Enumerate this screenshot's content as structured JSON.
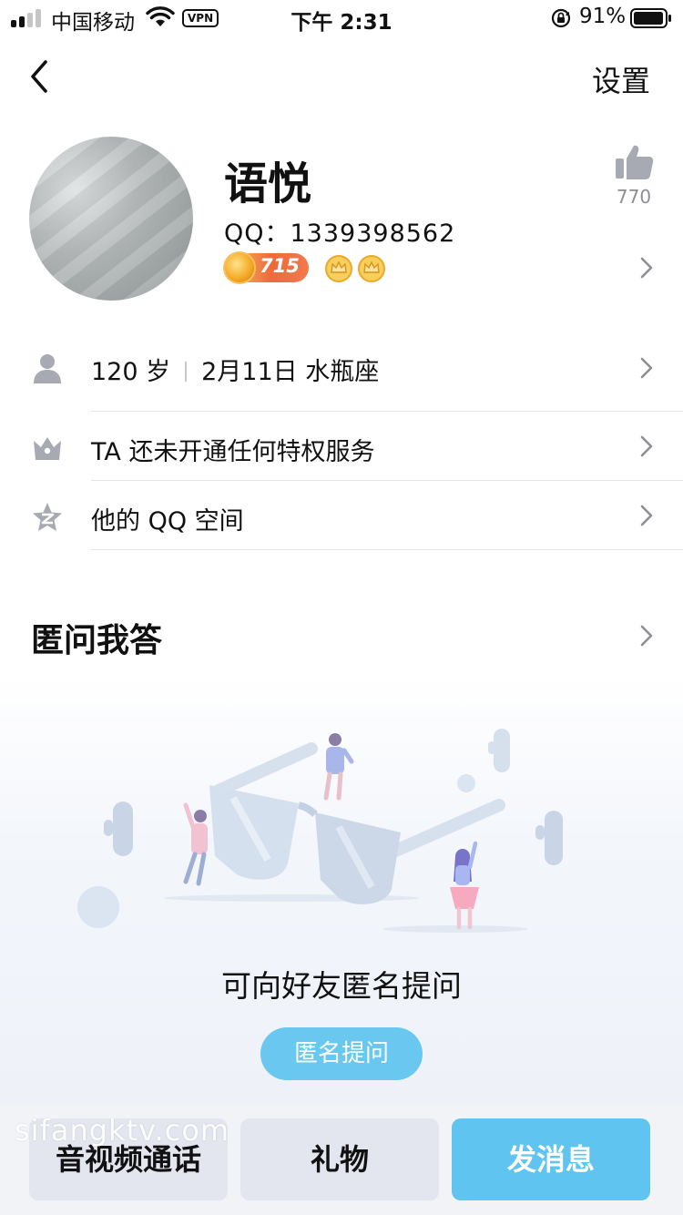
{
  "status_bar": {
    "carrier": "中国移动",
    "vpn": "VPN",
    "time": "下午 2:31",
    "battery_percent": "91%"
  },
  "nav": {
    "back_icon": "chevron-left-icon",
    "settings_label": "设置"
  },
  "profile": {
    "nickname": "语悦",
    "qq_number": "QQ：1339398562",
    "level": "715",
    "crown_count": 2,
    "likes": "770"
  },
  "info_rows": [
    {
      "icon": "person-icon",
      "age": "120 岁",
      "birthday": "2月11日 水瓶座"
    },
    {
      "icon": "crown-icon",
      "label": "TA 还未开通任何特权服务"
    },
    {
      "icon": "qzone-star-icon",
      "label": "他的 QQ 空间"
    }
  ],
  "anonymous_qa": {
    "title": "匿问我答",
    "empty_hint": "可向好友匿名提问",
    "ask_button": "匿名提问"
  },
  "bottom_bar": {
    "call_label": "音视频通话",
    "gift_label": "礼物",
    "message_label": "发消息"
  },
  "watermark": "sifangktv.com",
  "colors": {
    "accent": "#5fc4ef",
    "secondary_button": "#e4e6ef",
    "icon_gray": "#a7aab2"
  }
}
